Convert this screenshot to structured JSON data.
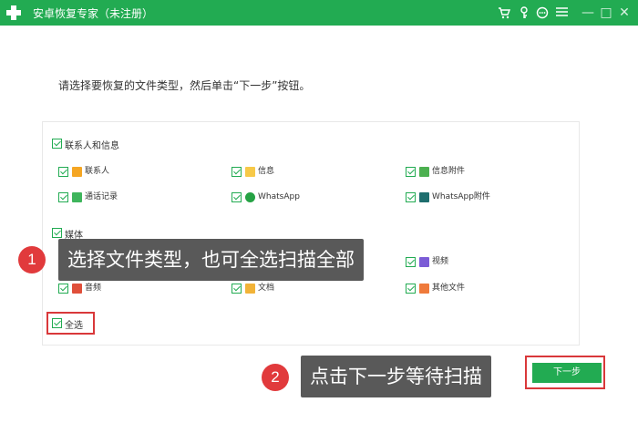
{
  "app": {
    "title": "安卓恢复专家（未注册）",
    "accent": "#22ab52"
  },
  "toolbar": {
    "icons": [
      "cart-icon",
      "key-icon",
      "chat-icon",
      "menu-icon"
    ],
    "window": {
      "minimize": "—",
      "maximize": "□",
      "close": "✕"
    }
  },
  "instruction": "请选择要恢复的文件类型，然后单击“下一步”按钮。",
  "groups": {
    "contacts": {
      "label": "联系人和信息",
      "items": [
        {
          "label": "联系人",
          "icon": "contact-icon"
        },
        {
          "label": "信息",
          "icon": "message-icon"
        },
        {
          "label": "信息附件",
          "icon": "attachment-icon"
        },
        {
          "label": "通话记录",
          "icon": "call-log-icon"
        },
        {
          "label": "WhatsApp",
          "icon": "whatsapp-icon"
        },
        {
          "label": "WhatsApp附件",
          "icon": "whatsapp-attachment-icon"
        }
      ]
    },
    "media": {
      "label": "媒体",
      "items": [
        {
          "label": "视频",
          "icon": "video-icon"
        },
        {
          "label": "音频",
          "icon": "audio-icon"
        },
        {
          "label": "文档",
          "icon": "document-icon"
        },
        {
          "label": "其他文件",
          "icon": "other-file-icon"
        }
      ]
    }
  },
  "select_all": "全选",
  "annotations": {
    "step1": {
      "number": "1",
      "text": "选择文件类型，也可全选扫描全部"
    },
    "step2": {
      "number": "2",
      "text": "点击下一步等待扫描"
    }
  },
  "next_button": "下一步",
  "colors": {
    "highlight": "#d9383a",
    "annotation_bg": "#595959"
  }
}
